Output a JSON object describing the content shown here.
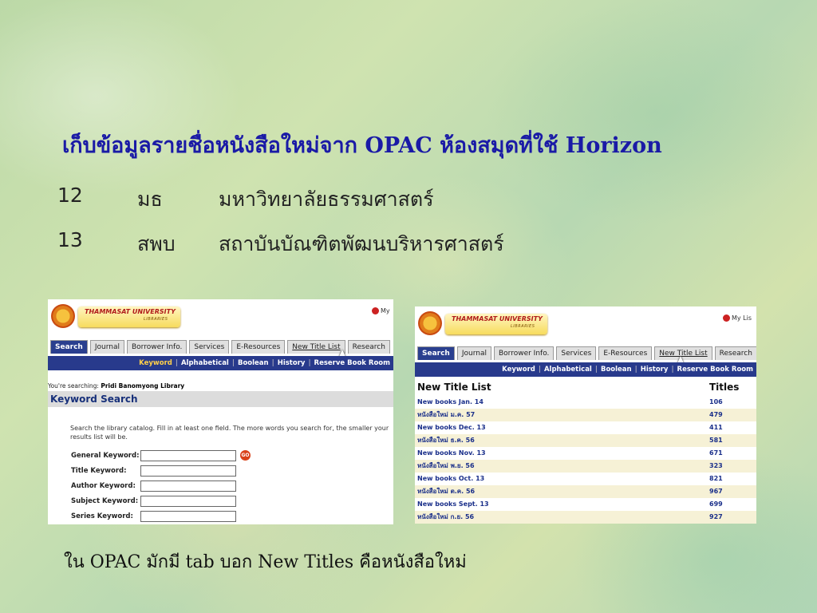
{
  "slide": {
    "title": "เก็บข้อมูลรายชื่อหนังสือใหม่จาก OPAC ห้องสมุดที่ใช้ Horizon",
    "rows": [
      {
        "num": "12",
        "abbr": "มธ",
        "name": "มหาวิทยาลัยธรรมศาสตร์"
      },
      {
        "num": "13",
        "abbr": "สพบ",
        "name": "สถาบันบัณฑิตพัฒนบริหารศาสตร์"
      }
    ],
    "caption": "ใน OPAC มักมี tab บอก New Titles คือหนังสือใหม่"
  },
  "screenshot_left": {
    "logo_text": "THAMMASAT UNIVERSITY",
    "logo_sub": "LIBRARIES",
    "my_link": "My",
    "tabs": [
      "Search",
      "Journal",
      "Borrower Info.",
      "Services",
      "E-Resources",
      "New Title List",
      "Research"
    ],
    "subnav": [
      "Keyword",
      "Alphabetical",
      "Boolean",
      "History",
      "Reserve Book Room"
    ],
    "searching_label": "You're searching:",
    "searching_value": "Pridi Banomyong Library",
    "section_title": "Keyword Search",
    "description": "Search the library catalog. Fill in at least one field. The more words you search for, the smaller your results list will be.",
    "fields": [
      "General Keyword:",
      "Title Keyword:",
      "Author Keyword:",
      "Subject Keyword:",
      "Series Keyword:"
    ],
    "go_label": "GO"
  },
  "screenshot_right": {
    "logo_text": "THAMMASAT UNIVERSITY",
    "logo_sub": "LIBRARIES",
    "my_link": "My Lis",
    "tabs": [
      "Search",
      "Journal",
      "Borrower Info.",
      "Services",
      "E-Resources",
      "New Title List",
      "Research"
    ],
    "subnav": [
      "Keyword",
      "Alphabetical",
      "Boolean",
      "History",
      "Reserve Book Room"
    ],
    "list_title": "New Title List",
    "titles_header": "Titles",
    "rows": [
      {
        "label": "New books Jan. 14",
        "count": "106"
      },
      {
        "label": "หนังสือใหม่ ม.ค. 57",
        "count": "479"
      },
      {
        "label": "New books Dec. 13",
        "count": "411"
      },
      {
        "label": "หนังสือใหม่ ธ.ค. 56",
        "count": "581"
      },
      {
        "label": "New books Nov. 13",
        "count": "671"
      },
      {
        "label": "หนังสือใหม่ พ.ย. 56",
        "count": "323"
      },
      {
        "label": "New books Oct. 13",
        "count": "821"
      },
      {
        "label": "หนังสือใหม่ ต.ค. 56",
        "count": "967"
      },
      {
        "label": "New books Sept. 13",
        "count": "699"
      },
      {
        "label": "หนังสือใหม่ ก.ย. 56",
        "count": "927"
      }
    ]
  }
}
